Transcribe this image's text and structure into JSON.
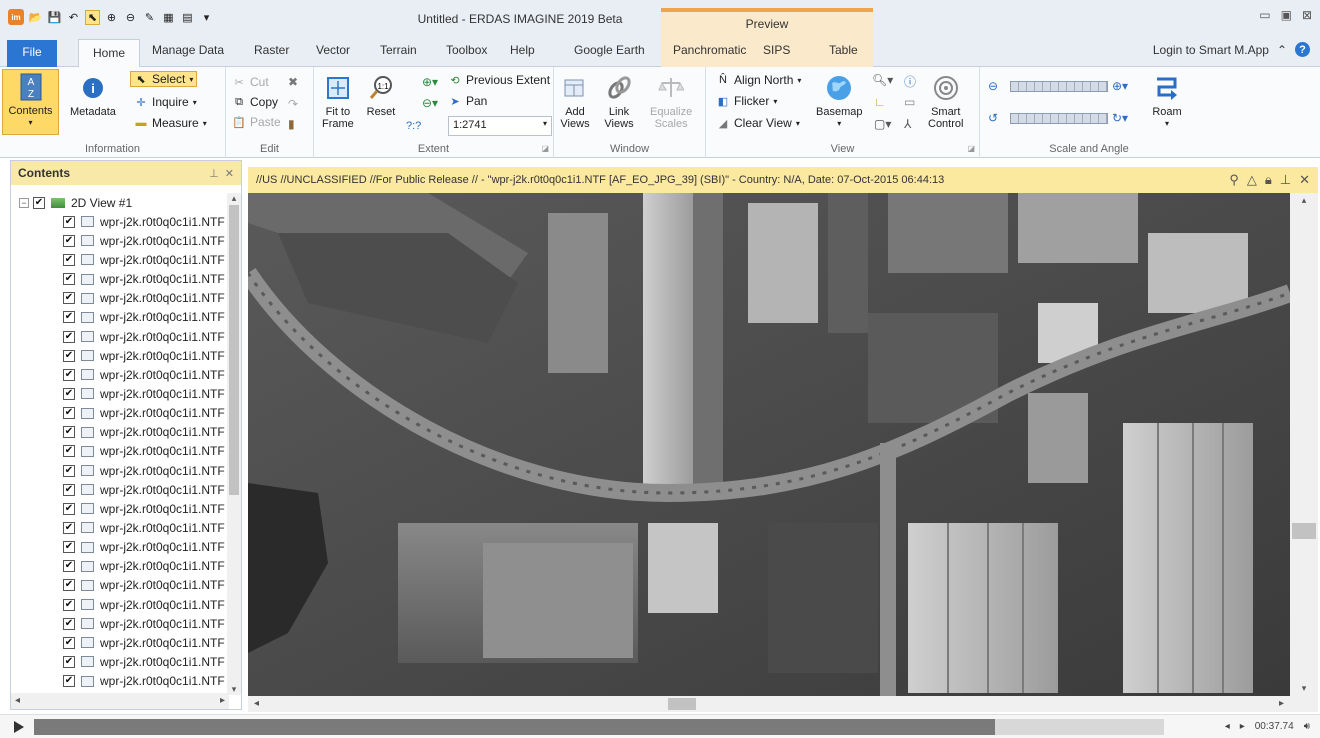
{
  "window": {
    "title": "Untitled - ERDAS IMAGINE 2019 Beta",
    "context_tab_group": "Preview",
    "controls": [
      "▭",
      "▣",
      "⊠"
    ]
  },
  "tabs": [
    "File",
    "Home",
    "Manage Data",
    "Raster",
    "Vector",
    "Terrain",
    "Toolbox",
    "Help",
    "Google Earth",
    "Panchromatic",
    "SIPS",
    "Table"
  ],
  "account": {
    "login_label": "Login to Smart M.App"
  },
  "ribbon": {
    "information": {
      "label": "Information",
      "contents": "Contents",
      "metadata": "Metadata",
      "select": "Select",
      "inquire": "Inquire",
      "measure": "Measure"
    },
    "edit": {
      "label": "Edit",
      "cut": "Cut",
      "copy": "Copy",
      "paste": "Paste"
    },
    "extent": {
      "label": "Extent",
      "fit_to_frame_1": "Fit to",
      "fit_to_frame_2": "Frame",
      "reset": "Reset",
      "previous_extent": "Previous Extent",
      "pan": "Pan",
      "scale_value": "1:2741",
      "unknown_scale": "?:?",
      "one_to_one": "1:1"
    },
    "window": {
      "label": "Window",
      "add_views_1": "Add",
      "add_views_2": "Views",
      "link_views_1": "Link",
      "link_views_2": "Views",
      "equalize_scales_1": "Equalize",
      "equalize_scales_2": "Scales"
    },
    "view": {
      "label": "View",
      "align_north": "Align North",
      "flicker": "Flicker",
      "clear_view": "Clear View",
      "basemap": "Basemap",
      "smart_control_1": "Smart",
      "smart_control_2": "Control"
    },
    "scale_angle": {
      "label": "Scale and Angle",
      "roam": "Roam"
    }
  },
  "contents_pane": {
    "title": "Contents",
    "root": "2D View #1",
    "layers": [
      "wpr-j2k.r0t0q0c1i1.NTF",
      "wpr-j2k.r0t0q0c1i1.NTF",
      "wpr-j2k.r0t0q0c1i1.NTF",
      "wpr-j2k.r0t0q0c1i1.NTF",
      "wpr-j2k.r0t0q0c1i1.NTF",
      "wpr-j2k.r0t0q0c1i1.NTF",
      "wpr-j2k.r0t0q0c1i1.NTF",
      "wpr-j2k.r0t0q0c1i1.NTF",
      "wpr-j2k.r0t0q0c1i1.NTF",
      "wpr-j2k.r0t0q0c1i1.NTF",
      "wpr-j2k.r0t0q0c1i1.NTF",
      "wpr-j2k.r0t0q0c1i1.NTF",
      "wpr-j2k.r0t0q0c1i1.NTF",
      "wpr-j2k.r0t0q0c1i1.NTF",
      "wpr-j2k.r0t0q0c1i1.NTF",
      "wpr-j2k.r0t0q0c1i1.NTF",
      "wpr-j2k.r0t0q0c1i1.NTF",
      "wpr-j2k.r0t0q0c1i1.NTF",
      "wpr-j2k.r0t0q0c1i1.NTF",
      "wpr-j2k.r0t0q0c1i1.NTF",
      "wpr-j2k.r0t0q0c1i1.NTF",
      "wpr-j2k.r0t0q0c1i1.NTF",
      "wpr-j2k.r0t0q0c1i1.NTF",
      "wpr-j2k.r0t0q0c1i1.NTF",
      "wpr-j2k.r0t0q0c1i1.NTF"
    ]
  },
  "view": {
    "header_text": "//US //UNCLASSIFIED //For Public Release // - \"wpr-j2k.r0t0q0c1i1.NTF [AF_EO_JPG_39] (SBI)\" - Country: N/A, Date: 07-Oct-2015 06:44:13"
  },
  "media": {
    "time": "00:37.74",
    "progress": 0.85
  },
  "colors": {
    "accent_blue": "#2b76d2",
    "selected_yellow": "#ffd966",
    "context_orange": "#f0a54a",
    "view_header": "#fbe9a0"
  }
}
